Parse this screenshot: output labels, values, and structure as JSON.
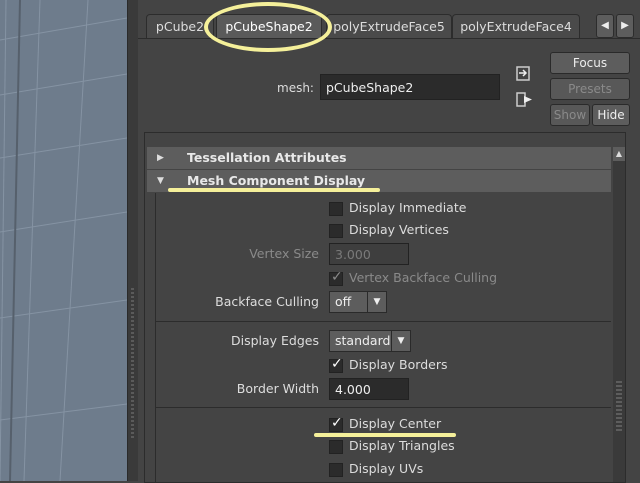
{
  "tabs": [
    {
      "label": "pCube2"
    },
    {
      "label": "pCubeShape2"
    },
    {
      "label": "polyExtrudeFace5"
    },
    {
      "label": "polyExtrudeFace4"
    }
  ],
  "tab_nav": {
    "left_icon": "triangle-left",
    "right_icon": "triangle-right"
  },
  "header": {
    "mesh_label": "mesh:",
    "mesh_value": "pCubeShape2",
    "focus_label": "Focus",
    "presets_label": "Presets",
    "show_label": "Show",
    "hide_label": "Hide"
  },
  "frames": {
    "tessellation": {
      "title": "Tessellation Attributes",
      "expanded": false
    },
    "mesh_component_display": {
      "title": "Mesh Component Display",
      "expanded": true
    }
  },
  "attributes": {
    "display_immediate": {
      "label": "Display Immediate",
      "checked": false
    },
    "display_vertices": {
      "label": "Display Vertices",
      "checked": false
    },
    "vertex_size": {
      "label": "Vertex Size",
      "value": "3.000",
      "enabled": false
    },
    "vertex_backface_culling": {
      "label": "Vertex Backface Culling",
      "checked": true,
      "enabled": false
    },
    "backface_culling": {
      "label": "Backface Culling",
      "value": "off"
    },
    "display_edges": {
      "label": "Display Edges",
      "value": "standard"
    },
    "display_borders": {
      "label": "Display Borders",
      "checked": true
    },
    "border_width": {
      "label": "Border Width",
      "value": "4.000"
    },
    "display_center": {
      "label": "Display Center",
      "checked": true
    },
    "display_triangles": {
      "label": "Display Triangles",
      "checked": false
    },
    "display_uvs": {
      "label": "Display UVs",
      "checked": false
    }
  },
  "colors": {
    "highlight": "#f5f09a",
    "panel_bg": "#444444",
    "viewport_bg": "#6e7c8c"
  }
}
